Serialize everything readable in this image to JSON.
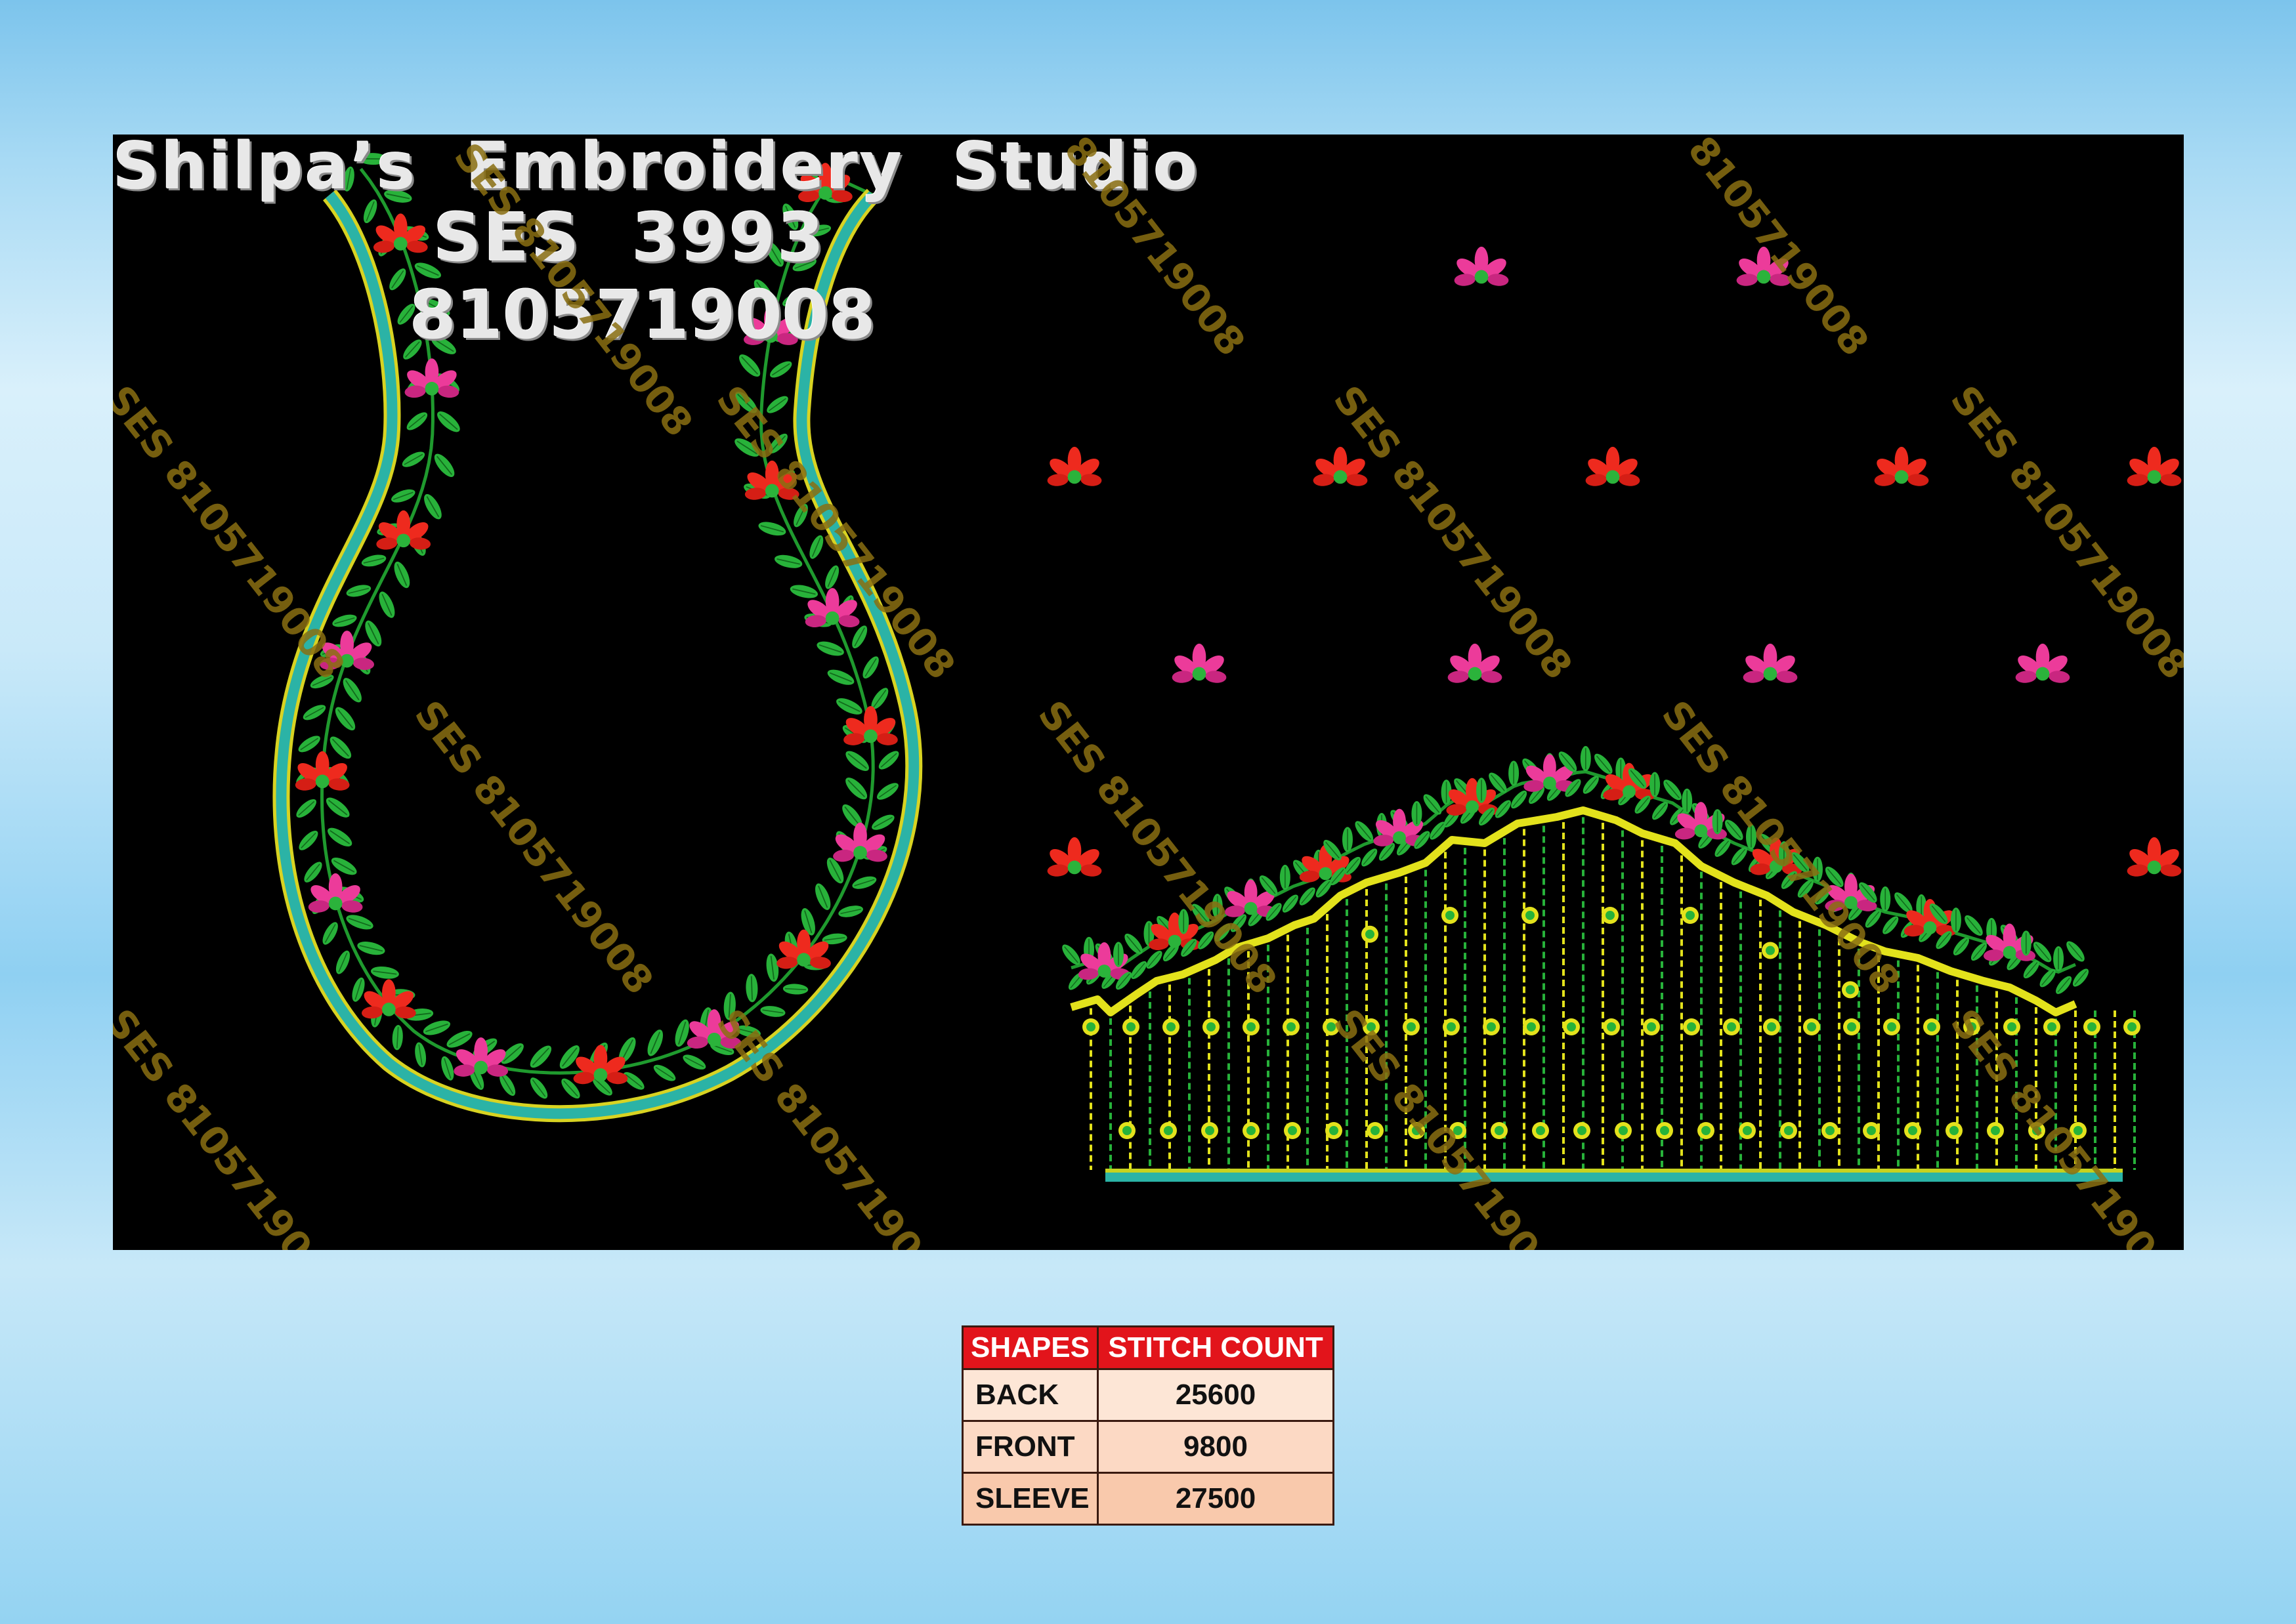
{
  "studio": {
    "name": "Shilpa’s  Embroidery  Studio",
    "code": "SES  3993",
    "phone": "8105719008"
  },
  "watermark": {
    "text": "SES 8105719008",
    "phone_only": "8105719008"
  },
  "stitch_table": {
    "headers": [
      "SHAPES",
      "STITCH COUNT"
    ],
    "rows": [
      {
        "shape": "BACK",
        "count": "25600"
      },
      {
        "shape": "FRONT",
        "count": "9800"
      },
      {
        "shape": "SLEEVE",
        "count": "27500"
      }
    ]
  },
  "colors": {
    "background": "#000000",
    "thread_teal": "#2bb3a6",
    "thread_yellow": "#e6e619",
    "thread_green": "#27b23a",
    "flower_red": "#ee2a1e",
    "flower_pink": "#ec3b9a",
    "header_red": "#e2141b"
  },
  "icons": [
    "flower-motif",
    "leaf-vine",
    "bead-string"
  ]
}
